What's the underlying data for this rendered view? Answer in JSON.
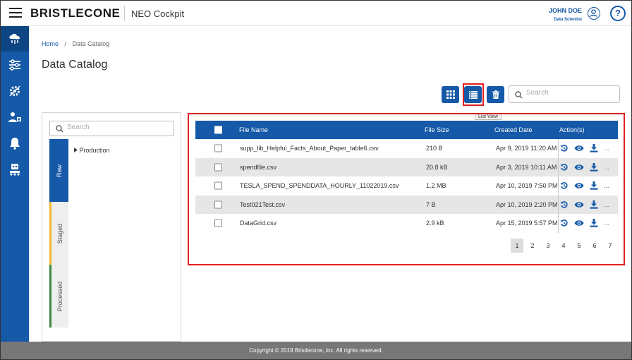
{
  "header": {
    "brand": "BRISTLECONE",
    "product": "NEO Cockpit",
    "user_name": "JOHN DOE",
    "user_role": "Data Scientist",
    "help_label": "?"
  },
  "nav": {
    "icons": [
      "cloud-data-icon",
      "pipeline-icon",
      "settings-gear-icon",
      "user-management-icon",
      "notification-bell-icon",
      "robot-icon"
    ]
  },
  "breadcrumb": {
    "home": "Home",
    "separator": "/",
    "current": "Data Catalog"
  },
  "page": {
    "title": "Data Catalog"
  },
  "toolbar": {
    "tooltip": "List View",
    "search_placeholder": "Search"
  },
  "left_panel": {
    "search_placeholder": "Search",
    "tabs": [
      {
        "label": "Raw",
        "color": "#1559a8",
        "text_color": "#ffffff"
      },
      {
        "label": "Staged",
        "color": "#f2b632",
        "text_color": "#555555"
      },
      {
        "label": "Processed",
        "color": "#3a8a3f",
        "text_color": "#555555"
      }
    ],
    "tree_item": "Production"
  },
  "table": {
    "headers": {
      "name": "File Name",
      "size": "File Size",
      "created": "Created Date",
      "actions": "Action(s)"
    },
    "rows": [
      {
        "name": "supp_lib_Helpful_Facts_About_Paper_table6.csv",
        "size": "210 B",
        "created": "Apr 9, 2019 11:20 AM"
      },
      {
        "name": "spendfile.csv",
        "size": "20.8 kB",
        "created": "Apr 3, 2019 10:11 AM"
      },
      {
        "name": "TESLA_SPEND_SPENDDATA_HOURLY_11022019.csv",
        "size": "1.2 MB",
        "created": "Apr 10, 2019 7:50 PM"
      },
      {
        "name": "Test021Test.csv",
        "size": "7 B",
        "created": "Apr 10, 2019 2:20 PM"
      },
      {
        "name": "DataGrid.csv",
        "size": "2.9 kB",
        "created": "Apr 15, 2019 5:57 PM"
      }
    ],
    "more_label": "..."
  },
  "pagination": {
    "pages": [
      "1",
      "2",
      "3",
      "4",
      "5",
      "6",
      "7"
    ],
    "active": "1"
  },
  "footer": {
    "copyright": "Copyright © 2019 Bristlecone, Inc. All rights reserved."
  },
  "colors": {
    "primary": "#1559a8",
    "highlight": "#e02020"
  }
}
